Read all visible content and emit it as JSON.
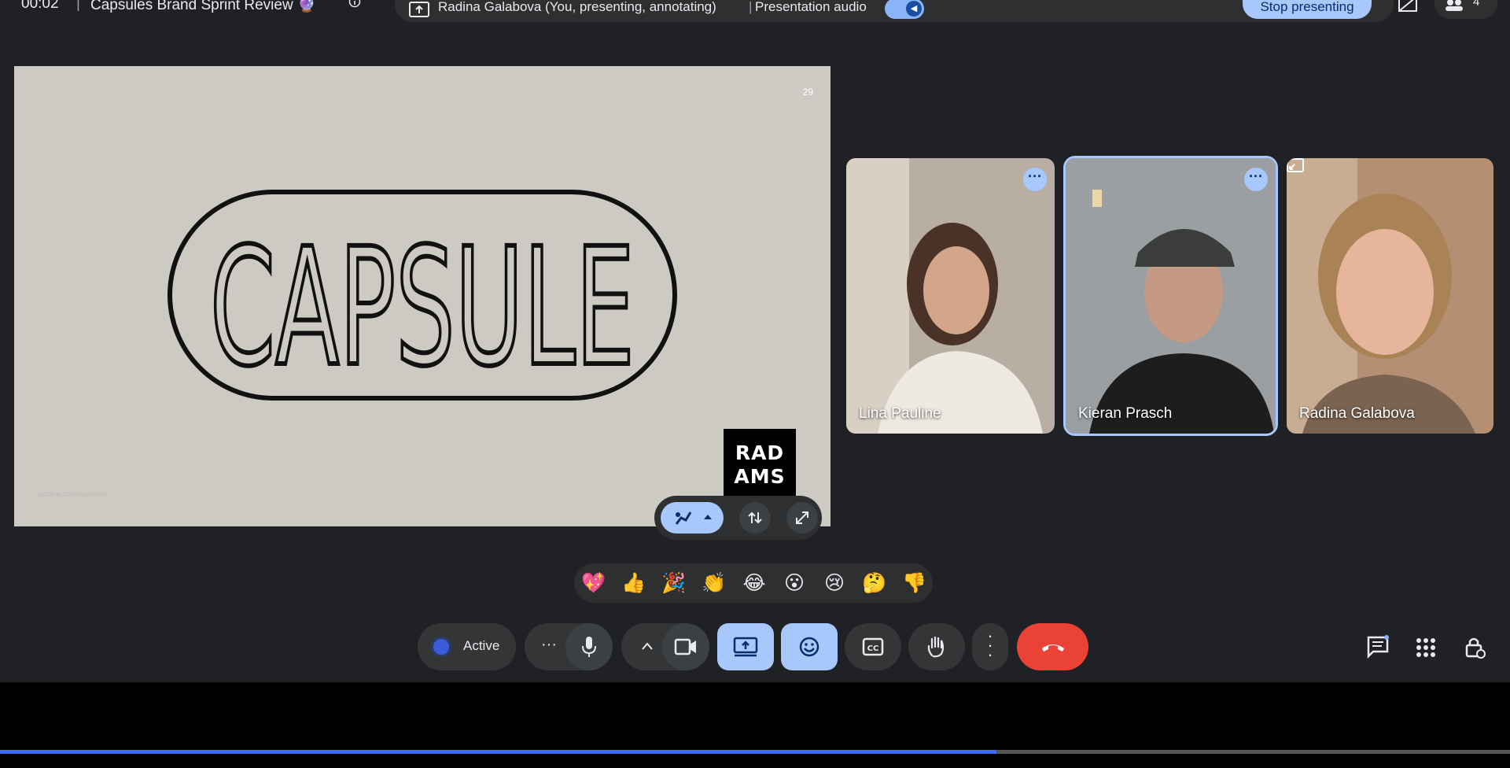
{
  "top_bar": {
    "timer": "00:02",
    "separator": "|",
    "meeting_title": "Capsules Brand Sprint Review 🔮"
  },
  "presenting_banner": {
    "presenter_text": "Radina Galabova (You, presenting, annotating)",
    "separator": "|",
    "audio_label": "Presentation audio",
    "stop_label": "Stop presenting"
  },
  "participants_count": "4",
  "slide": {
    "page_number": "29",
    "headline": "CAPSULE",
    "logo_line1": "RAD",
    "logo_line2": "AMS",
    "footnote": "radams.com/capsules"
  },
  "tiles": [
    {
      "name": "Lina Pauline"
    },
    {
      "name": "Kieran Prasch"
    },
    {
      "name": "Radina Galabova"
    }
  ],
  "reactions": [
    "💖",
    "👍",
    "🎉",
    "👏",
    "😂",
    "😮",
    "😢",
    "🤔",
    "👎"
  ],
  "controls": {
    "active_label": "Active"
  },
  "progress": {
    "fraction": 0.66
  },
  "colors": {
    "accent": "#a8c7fa",
    "end_call": "#ea4335",
    "background": "#202124"
  }
}
